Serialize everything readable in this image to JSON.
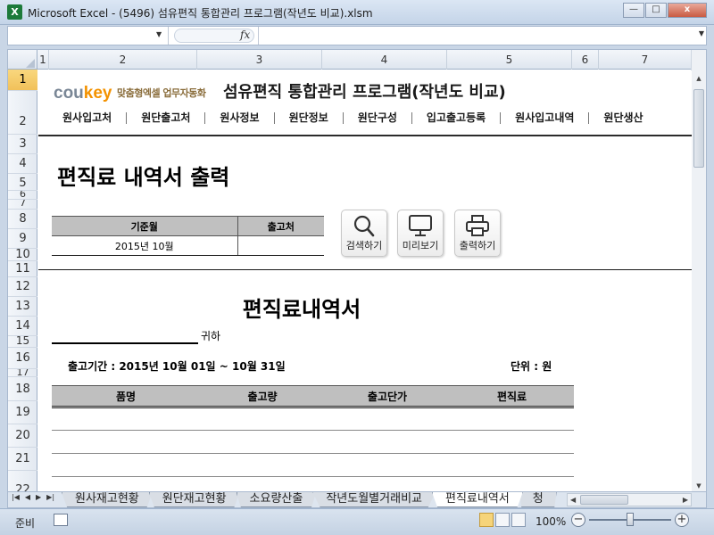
{
  "window": {
    "title": "Microsoft Excel - (5496) 섬유편직 통합관리 프로그램(작년도 비교).xlsm",
    "app_icon": "X",
    "minimize": "—",
    "maximize": "□",
    "close": "x"
  },
  "formula_bar": {
    "name_box": "",
    "fx_label": "fx",
    "formula": ""
  },
  "columns": [
    "1",
    "2",
    "3",
    "4",
    "5",
    "6",
    "7"
  ],
  "rows": [
    "1",
    "2",
    "3",
    "4",
    "5",
    "6",
    "7",
    "8",
    "9",
    "10",
    "11",
    "12",
    "13",
    "14",
    "15",
    "16",
    "17",
    "18",
    "19",
    "20",
    "21",
    "22"
  ],
  "header": {
    "logo_cou": "cou",
    "logo_key": "key",
    "logo_subtitle": "맞춤형엑셀 업무자동화",
    "app_title": "섬유편직 통합관리 프로그램(작년도 비교)"
  },
  "menu": [
    "원사입고처",
    "원단출고처",
    "원사정보",
    "원단정보",
    "원단구성",
    "입고출고등록",
    "원사입고내역",
    "원단생산"
  ],
  "page_heading": "편직료 내역서 출력",
  "filter": {
    "headers": [
      "기준월",
      "출고처"
    ],
    "values": [
      "2015년 10월",
      ""
    ]
  },
  "buttons": {
    "search": "검색하기",
    "preview": "미리보기",
    "print": "출력하기"
  },
  "document": {
    "title": "편직료내역서",
    "recipient": "",
    "honorific": "귀하",
    "period": "출고기간 : 2015년 10월 01일 ~ 10월 31일",
    "unit": "단위 : 원",
    "table_headers": [
      "품명",
      "출고량",
      "출고단가",
      "편직료"
    ]
  },
  "sheet_tabs": [
    "원사재고현황",
    "원단재고현황",
    "소요량산출",
    "작년도월별거래비교",
    "편직료내역서",
    "청"
  ],
  "active_tab": "편직료내역서",
  "status": {
    "ready": "준비",
    "zoom": "100%",
    "zoom_minus": "−",
    "zoom_plus": "+"
  }
}
